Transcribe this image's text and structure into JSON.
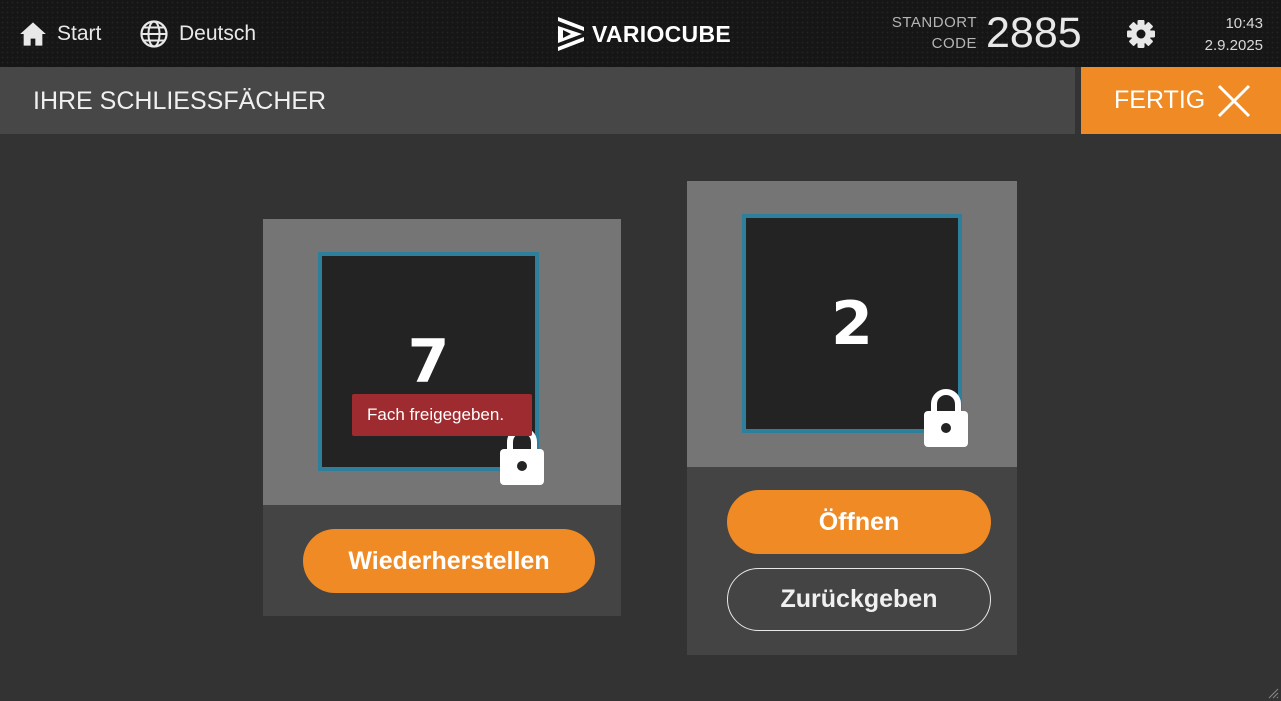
{
  "header": {
    "home_label": "Start",
    "language_label": "Deutsch",
    "brand": "VARIOCUBE",
    "standort_label_1": "STANDORT",
    "standort_label_2": "CODE",
    "location_code": "2885",
    "time": "10:43",
    "date": "2.9.2025"
  },
  "titlebar": {
    "title": "IHRE SCHLIESSFÄCHER",
    "done_label": "FERTIG"
  },
  "lockers": [
    {
      "number": "7",
      "status_message": "Fach freigegeben.",
      "actions": [
        "Wiederherstellen"
      ]
    },
    {
      "number": "2",
      "actions": [
        "Öffnen",
        "Zurückgeben"
      ]
    }
  ],
  "colors": {
    "accent": "#f08a24",
    "locker_border": "#2e7f9b",
    "error": "#9e2b2f"
  }
}
